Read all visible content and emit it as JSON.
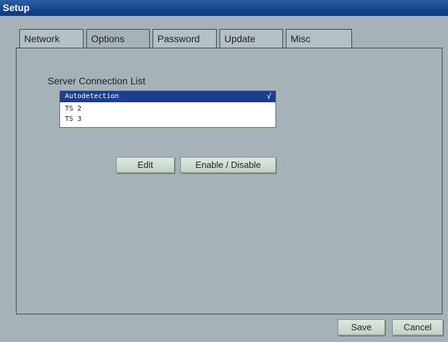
{
  "window": {
    "title": "Setup"
  },
  "tabs": [
    {
      "label": "Network",
      "active": false
    },
    {
      "label": "Options",
      "active": true
    },
    {
      "label": "Password",
      "active": false
    },
    {
      "label": "Update",
      "active": false
    },
    {
      "label": "Misc",
      "active": false
    }
  ],
  "options": {
    "section_label": "Server Connection List",
    "server_list": [
      {
        "label": "Autodetection",
        "selected": true,
        "checked": true
      },
      {
        "label": "TS 2",
        "selected": false,
        "checked": false
      },
      {
        "label": "TS 3",
        "selected": false,
        "checked": false
      }
    ],
    "check_glyph": "√",
    "edit_label": "Edit",
    "enable_disable_label": "Enable / Disable"
  },
  "footer": {
    "save_label": "Save",
    "cancel_label": "Cancel"
  },
  "colors": {
    "background": "#a5b3b9",
    "titlebar": "#16468d",
    "selection": "#1d3e8e",
    "button_face": "#cfdcd1"
  }
}
